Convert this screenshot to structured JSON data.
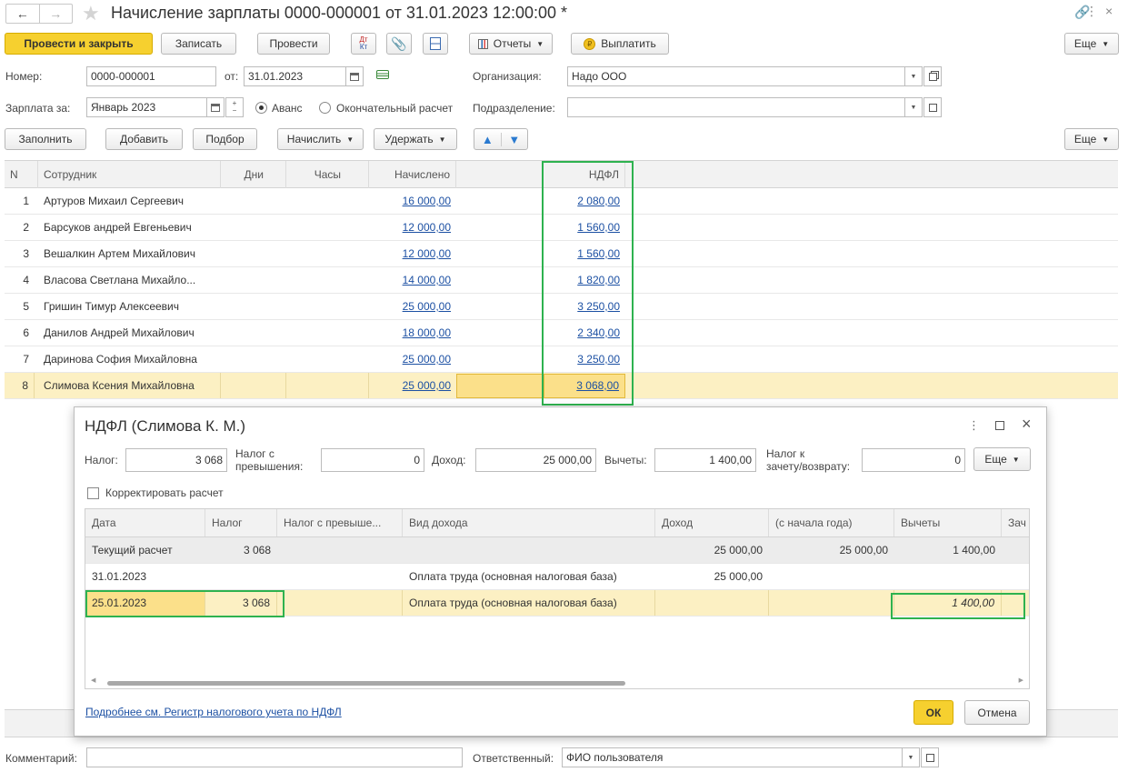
{
  "window": {
    "title": "Начисление зарплаты 0000-000001 от 31.01.2023 12:00:00 *"
  },
  "toolbar": {
    "post_and_close": "Провести и закрыть",
    "save": "Записать",
    "post": "Провести",
    "dt_kt": "Дт Кт",
    "reports": "Отчеты",
    "pay": "Выплатить",
    "more": "Еще"
  },
  "header": {
    "number_label": "Номер:",
    "number_value": "0000-000001",
    "date_label": "от:",
    "date_value": "31.01.2023",
    "org_label": "Организация:",
    "org_value": "Надо ООО",
    "salary_for_label": "Зарплата за:",
    "salary_for_value": "Январь 2023",
    "advance_label": "Аванс",
    "final_label": "Окончательный расчет",
    "dept_label": "Подразделение:",
    "dept_value": ""
  },
  "table_toolbar": {
    "fill": "Заполнить",
    "add": "Добавить",
    "select": "Подбор",
    "accrue": "Начислить",
    "withhold": "Удержать",
    "more": "Еще"
  },
  "main_table": {
    "columns": [
      "N",
      "Сотрудник",
      "Дни",
      "Часы",
      "Начислено",
      "НДФЛ"
    ],
    "rows": [
      {
        "n": "1",
        "name": "Артуров Михаил Сергеевич",
        "accrued": "16 000,00",
        "ndfl": "2 080,00"
      },
      {
        "n": "2",
        "name": "Барсуков андрей Евгеньевич",
        "accrued": "12 000,00",
        "ndfl": "1 560,00"
      },
      {
        "n": "3",
        "name": "Вешалкин Артем Михайлович",
        "accrued": "12 000,00",
        "ndfl": "1 560,00"
      },
      {
        "n": "4",
        "name": "Власова Светлана Михайло...",
        "accrued": "14 000,00",
        "ndfl": "1 820,00"
      },
      {
        "n": "5",
        "name": "Гришин Тимур Алексеевич",
        "accrued": "25 000,00",
        "ndfl": "3 250,00"
      },
      {
        "n": "6",
        "name": "Данилов Андрей Михайлович",
        "accrued": "18 000,00",
        "ndfl": "2 340,00"
      },
      {
        "n": "7",
        "name": "Даринова София Михайловна",
        "accrued": "25 000,00",
        "ndfl": "3 250,00"
      },
      {
        "n": "8",
        "name": "Слимова Ксения Михайловна",
        "accrued": "25 000,00",
        "ndfl": "3 068,00"
      }
    ]
  },
  "dialog": {
    "title": "НДФЛ (Слимова К. М.)",
    "tax_label": "Налог:",
    "tax_value": "3 068",
    "tax_excess_label_1": "Налог с",
    "tax_excess_label_2": "превышения:",
    "tax_excess_value": "0",
    "income_label": "Доход:",
    "income_value": "25 000,00",
    "deductions_label": "Вычеты:",
    "deductions_value": "1 400,00",
    "offset_label_1": "Налог к",
    "offset_label_2": "зачету/возврату:",
    "offset_value": "0",
    "more": "Еще",
    "correct_label": "Корректировать расчет",
    "columns": [
      "Дата",
      "Налог",
      "Налог с превыше...",
      "Вид дохода",
      "Доход",
      "(с начала года)",
      "Вычеты",
      "Зач"
    ],
    "rows": [
      {
        "date": "Текущий расчет",
        "tax": "3 068",
        "excess": "",
        "kind": "",
        "income": "25 000,00",
        "ytd": "25 000,00",
        "deductions": "1 400,00"
      },
      {
        "date": "31.01.2023",
        "tax": "",
        "excess": "",
        "kind": "Оплата труда (основная налоговая база)",
        "income": "25 000,00",
        "ytd": "",
        "deductions": ""
      },
      {
        "date": "25.01.2023",
        "tax": "3 068",
        "excess": "",
        "kind": "Оплата труда (основная налоговая база)",
        "income": "",
        "ytd": "",
        "deductions": "1 400,00"
      }
    ],
    "link": "Подробнее см. Регистр налогового учета по НДФЛ",
    "ok": "ОК",
    "cancel": "Отмена"
  },
  "footer": {
    "comment_label": "Комментарий:",
    "comment_value": "",
    "responsible_label": "Ответственный:",
    "responsible_value": "ФИО пользователя"
  },
  "colors": {
    "accent_yellow": "#f6d02f",
    "link_blue": "#1c50a3",
    "selection": "#fcf0c3",
    "highlight_green": "#2eb24f"
  }
}
